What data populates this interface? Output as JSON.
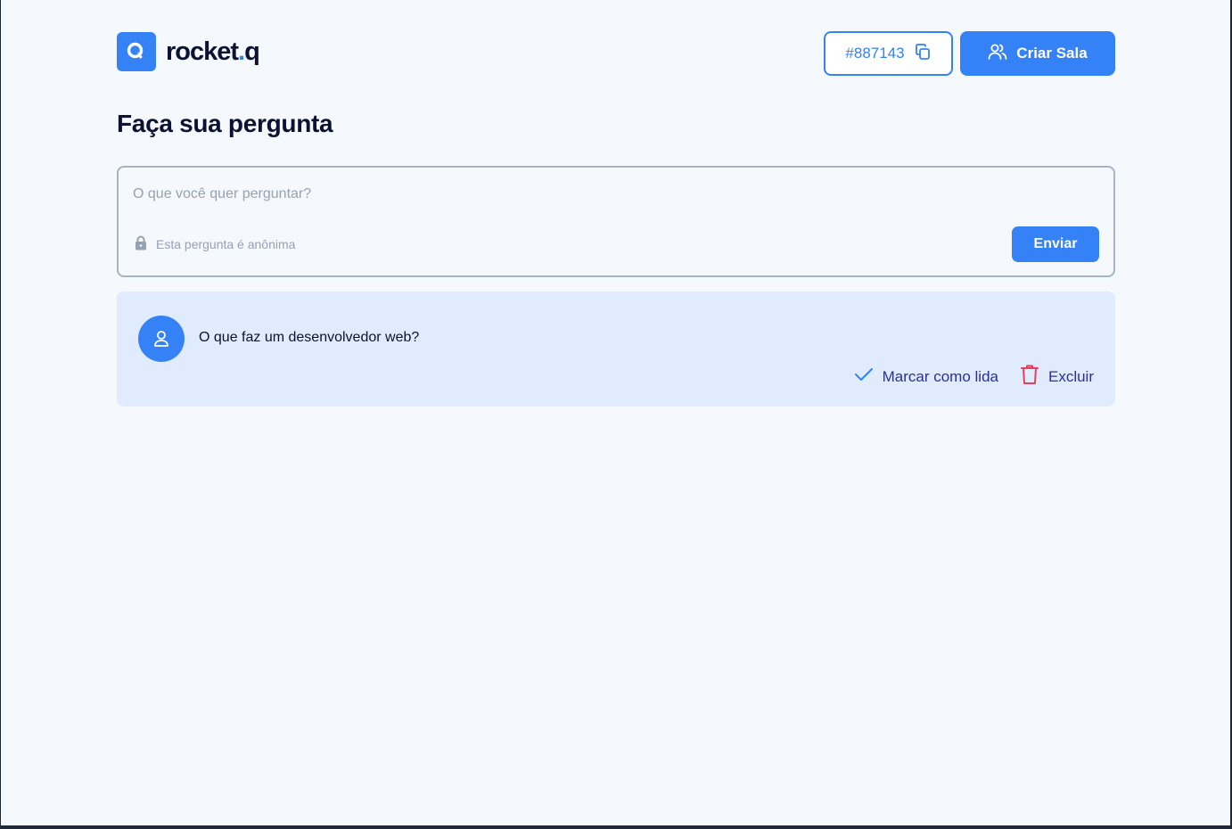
{
  "brand": {
    "name_main": "rocket",
    "name_dot": ".",
    "name_tail": "q",
    "accent": "#3482f6",
    "dark": "#0b1232"
  },
  "header": {
    "room_code": "#887143",
    "create_room_label": "Criar Sala"
  },
  "page_title": "Faça sua pergunta",
  "form": {
    "placeholder": "O que você quer perguntar?",
    "anonymous_note": "Esta pergunta é anônima",
    "send_label": "Enviar"
  },
  "questions": [
    {
      "text": "O que faz um desenvolvedor web?",
      "mark_read_label": "Marcar como lida",
      "delete_label": "Excluir"
    }
  ],
  "icons": {
    "logo": "search-icon",
    "copy": "copy-icon",
    "users": "users-icon",
    "lock": "lock-icon",
    "avatar": "user-icon",
    "check": "check-icon",
    "trash": "trash-icon"
  },
  "colors": {
    "delete": "#e73f5d",
    "action_text": "#2a2fa0"
  }
}
